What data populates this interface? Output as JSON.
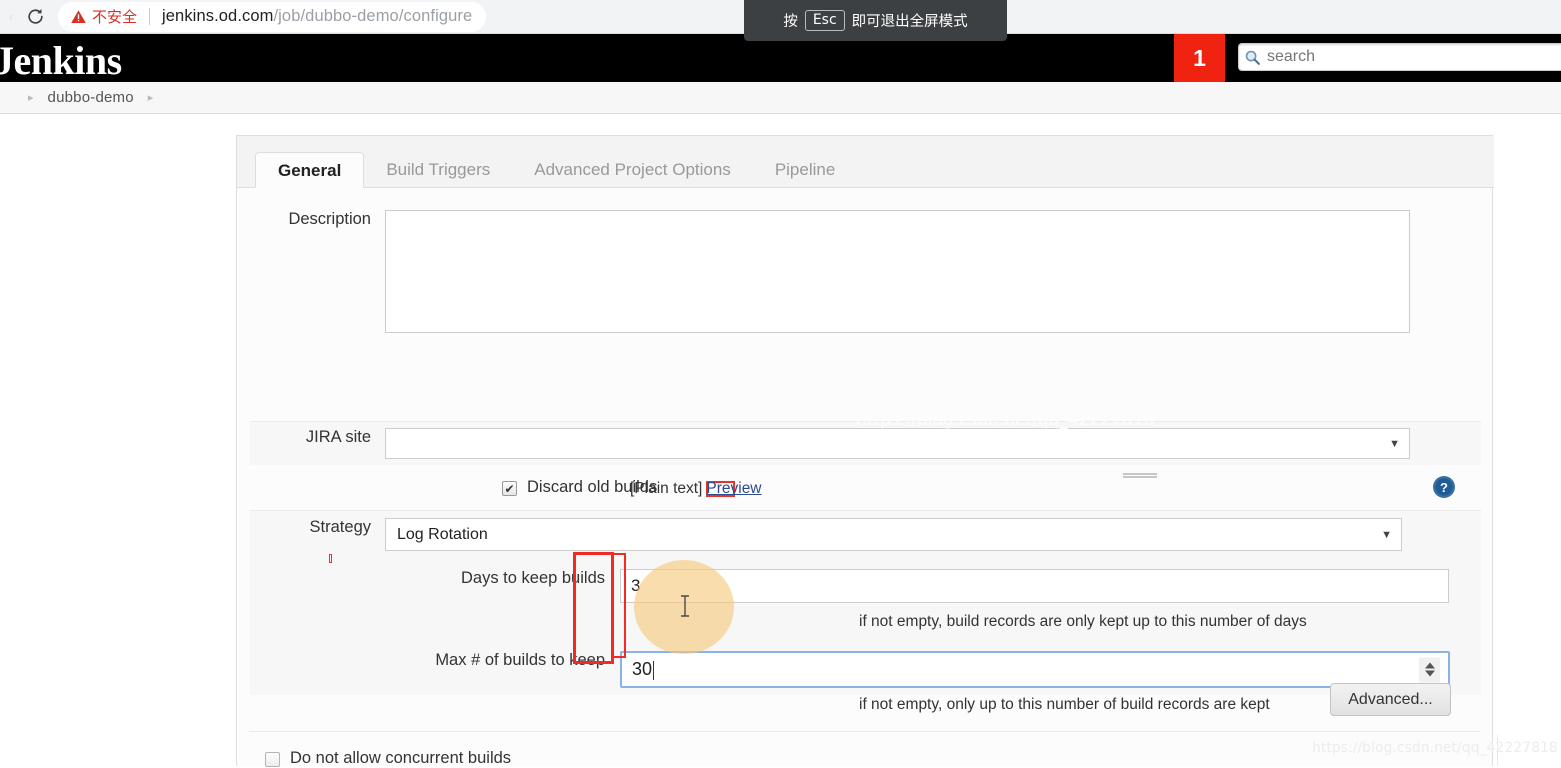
{
  "browser": {
    "back_ghost": "‹",
    "reload_icon": "reload-icon",
    "security_warning_icon": "warning-triangle-icon",
    "security_label": "不安全",
    "url_host": "jenkins.od.com",
    "url_path": "/job/dubbo-demo/configure",
    "fullscreen_toast": {
      "prefix": "按",
      "key": "Esc",
      "suffix": "即可退出全屏模式"
    }
  },
  "header": {
    "logo": "Jenkins",
    "notification_count": "1",
    "search_placeholder": "search",
    "search_icon": "search-icon",
    "badge_color": "#f02311"
  },
  "breadcrumb": {
    "arrow": "▸",
    "project": "dubbo-demo"
  },
  "tabs": [
    {
      "label": "General",
      "active": true
    },
    {
      "label": "Build Triggers",
      "active": false
    },
    {
      "label": "Advanced Project Options",
      "active": false
    },
    {
      "label": "Pipeline",
      "active": false
    }
  ],
  "form": {
    "description": {
      "label": "Description",
      "value": "",
      "watermark": "https://blog.csdn.net/qq_42227818",
      "format_note": "[Plain text]",
      "preview_link": "Preview"
    },
    "jira_site": {
      "label": "JIRA site",
      "value": "",
      "dropdown_arrow": "▼"
    },
    "discard_old_builds": {
      "label": "Discard old builds",
      "checked": true,
      "check_glyph": "✔",
      "help_icon": "help-question-icon"
    },
    "strategy": {
      "label": "Strategy",
      "value": "Log Rotation",
      "dropdown_arrow": "▼"
    },
    "days_to_keep_builds": {
      "label": "Days to keep builds",
      "value": "3",
      "hint": "if not empty, build records are only kept up to this number of days"
    },
    "max_builds_to_keep": {
      "label": "Max # of builds to keep",
      "value": "30",
      "hint": "if not empty, only up to this number of build records are kept",
      "focused": true,
      "spinner_icon": "number-spinner-icon"
    },
    "advanced_button": "Advanced...",
    "concurrent_builds": {
      "label": "Do not allow concurrent builds",
      "checked": false
    }
  },
  "watermark": "https://blog.csdn.net/qq_42227818",
  "annotations": {
    "highlight_color": "#ee2b24",
    "click_highlight_color": "#f7c87a"
  }
}
